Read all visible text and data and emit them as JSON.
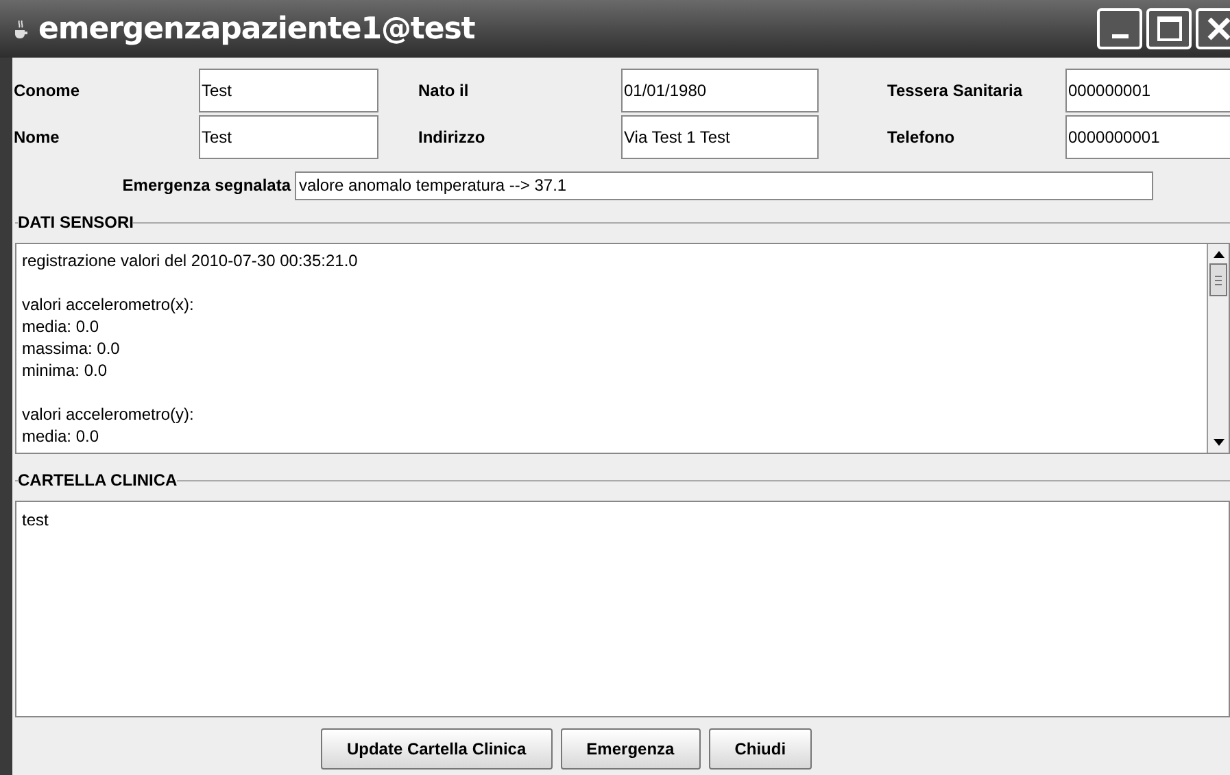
{
  "window": {
    "title": "emergenzapaziente1@test"
  },
  "fields": [
    {
      "label": "Conome",
      "value": "Test"
    },
    {
      "label": "Nato il",
      "value": "01/01/1980"
    },
    {
      "label": "Tessera Sanitaria",
      "value": "000000001"
    },
    {
      "label": "Nome",
      "value": "Test"
    },
    {
      "label": "Indirizzo",
      "value": "Via Test 1 Test"
    },
    {
      "label": "Telefono",
      "value": "0000000001"
    }
  ],
  "emergency": {
    "label": "Emergenza segnalata",
    "value": "valore anomalo temperatura --> 37.1"
  },
  "sensors": {
    "title": "DATI SENSORI",
    "paragraphs": [
      [
        "registrazione valori del 2010-07-30 00:35:21.0"
      ],
      [
        "valori accelerometro(x):",
        "media: 0.0",
        "massima: 0.0",
        "minima: 0.0"
      ],
      [
        "valori accelerometro(y):",
        "media: 0.0"
      ]
    ]
  },
  "record": {
    "title": "CARTELLA CLINICA",
    "value": "test"
  },
  "buttons": [
    "Update Cartella Clinica",
    "Emergenza",
    "Chiudi"
  ]
}
